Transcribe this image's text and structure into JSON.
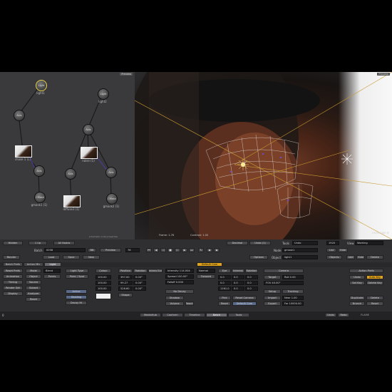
{
  "schematic": {
    "badge": "Preview",
    "nodes": {
      "light1": "Light",
      "light1_cap": "light1",
      "light2": "Light",
      "light2_cap": "light2",
      "axis1": "Axis",
      "axis2": "Axis",
      "axis3": "Axis",
      "axis4": "Axis",
      "axis5": "Axis",
      "axis6": "Axis",
      "cmask1": "CMask",
      "cmask2": "CMask",
      "img1_cap": "chase 1 (1)",
      "img2_cap": "noise (1)",
      "img3_cap": "diffuse3 (1)",
      "cmask1_cap": "gmask1 (1)",
      "cmask2_cap": "gmask2 (1)"
    },
    "footer": "schematic node properties"
  },
  "viewer": {
    "badge": "Preview",
    "top_right_1": "1920x1080 @",
    "footer_left": "Frame: 1-76",
    "footer_mid": "Contrast: 1.00",
    "footer_right": "Frame: 1.00"
  },
  "header": {
    "hidden": "Hidden",
    "tab1": "1 Up",
    "tab2": "All Nodes",
    "center_field": "Decimal",
    "center_field2": "Undo (1)",
    "tools_label": "Tools",
    "tools_value": "Undo",
    "fps": "1920",
    "view_label": "View",
    "view_value": "Working"
  },
  "row2": {
    "batch_label": "Batch",
    "batch_value": "0058",
    "bb": "BB",
    "preview": "Preview",
    "frame_field": "76",
    "node_label": "Node",
    "node_value": "gmask1",
    "list": "List",
    "hist": "Hide",
    "render": "Render",
    "load": "Load",
    "save": "Save",
    "new": "New",
    "options": "Options",
    "object_label": "Object",
    "object_value": "light1",
    "objects": "Objects",
    "add": "Add",
    "hide": "Hide",
    "delete": "Delete"
  },
  "node_tabs": {
    "t1": "Batch Prefs",
    "t2": "Action Mtr",
    "t3": "Light",
    "sel": "Default Cam"
  },
  "left_col": {
    "rows": [
      "Reset Prefs",
      "Animation",
      "Timing",
      "Render Set",
      "Display",
      "Reset"
    ],
    "col2": [
      "Mode",
      "Object",
      "Source",
      "Subset",
      "Analyzer",
      "Reset"
    ],
    "col3": [
      "Blend",
      "Points"
    ]
  },
  "light_panel": {
    "light_type": "Light Type",
    "type_value": "Point / Spot",
    "active": "Active",
    "shading": "Shading",
    "decay": "Decay Hi",
    "colour": "Colour",
    "vals": [
      "100.00",
      "100.00",
      "100.00"
    ],
    "position": "Position",
    "rotation": "Rotation",
    "intensity_l": "Intens Ext",
    "pos_vals": [
      "397.00",
      "99.27",
      "528.60"
    ],
    "rot_vals": [
      "0.00°",
      "0.00°",
      "0.00°"
    ],
    "shape": "Shape",
    "intensity": "Intensity 114.004",
    "spread": "Spread 100.00°",
    "falloff": "Falloff 0.000",
    "no_decay": "No Decay",
    "apply_all": "Apply All",
    "shadow": "Shadow",
    "volume": "Volume",
    "reach": "Reach",
    "unit": "N/A"
  },
  "camera_panel": {
    "normal": "Normal",
    "forward": "Forward",
    "eye": "Eye",
    "interest": "Interest",
    "rotation": "Rotation",
    "eye_vals": [
      "0.0",
      "0.0",
      "1161.0"
    ],
    "int_vals": [
      "0.0",
      "0.0",
      "0.0"
    ],
    "rot_vals": [
      "0.0",
      "0.0",
      "0.0"
    ],
    "pick": "Pick",
    "reset_camera": "Reset Camera",
    "reset": "Reset",
    "default_cam": "Default Cam",
    "camera": "Camera",
    "target": "Target",
    "target_val": "Roll 0.00",
    "fov": "FOV 40.00°",
    "near": "Near 1.00",
    "setup": "Setup",
    "tracking": "Tracking",
    "import": "Import",
    "export": "Export",
    "far": "Far 10000.00"
  },
  "right_col": {
    "action_prefs": "Action Prefs",
    "undo": "Undo",
    "auto_key": "Auto Key",
    "set_key": "Set Key",
    "delete_key": "Delete Key",
    "duplicate": "Duplicate",
    "delete": "Delete",
    "branch": "Branch",
    "reset": "Reset"
  },
  "bottom_tabs": [
    "MediaHub",
    "Conform",
    "Timeline",
    "Batch",
    "Tools"
  ],
  "bottom_right": {
    "undo": "Undo",
    "redo": "Redo",
    "brand": "FLAME",
    "left_num": "0"
  },
  "colors": {
    "accent": "#e0a21a",
    "selected": "#e6d14a",
    "mesh": "#e8e8e8",
    "guide": "#c99a30"
  }
}
